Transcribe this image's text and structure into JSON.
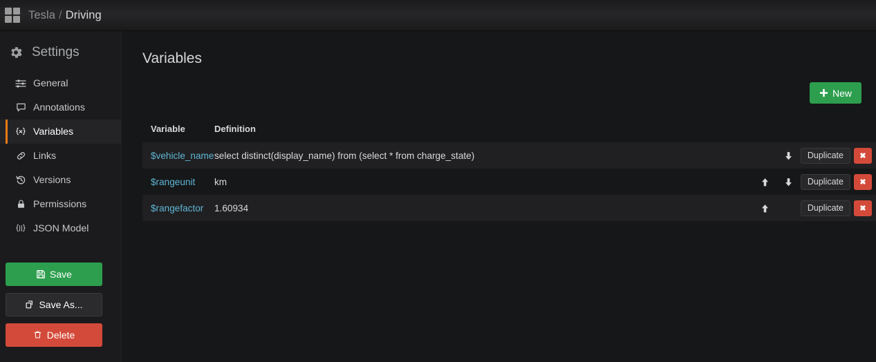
{
  "topnav": {
    "logo_icon": "grid-icon",
    "breadcrumb_parent": "Tesla",
    "breadcrumb_separator": "/",
    "breadcrumb_current": "Driving"
  },
  "sidebar": {
    "heading": "Settings",
    "heading_icon": "gear-icon",
    "items": [
      {
        "label": "General",
        "icon": "sliders-icon",
        "active": false
      },
      {
        "label": "Annotations",
        "icon": "comment-icon",
        "active": false
      },
      {
        "label": "Variables",
        "icon": "braces-x-icon",
        "active": true
      },
      {
        "label": "Links",
        "icon": "link-icon",
        "active": false
      },
      {
        "label": "Versions",
        "icon": "history-icon",
        "active": false
      },
      {
        "label": "Permissions",
        "icon": "lock-icon",
        "active": false
      },
      {
        "label": "JSON Model",
        "icon": "json-icon",
        "active": false
      }
    ],
    "actions": [
      {
        "label": "Save",
        "icon": "save-icon",
        "color": "#2d9e4e"
      },
      {
        "label": "Save As...",
        "icon": "copy-icon",
        "color": "#2b2b2e"
      },
      {
        "label": "Delete",
        "icon": "trash-icon",
        "color": "#d44a3a"
      }
    ]
  },
  "main": {
    "title": "Variables",
    "new_button": {
      "label": "New",
      "icon": "plus-icon"
    },
    "table": {
      "columns": [
        "Variable",
        "Definition"
      ],
      "duplicate_label": "Duplicate",
      "delete_label": "✖",
      "rows": [
        {
          "variable": "$vehicle_name",
          "definition": "select distinct(display_name) from (select * from charge_state)",
          "can_move_up": false,
          "can_move_down": true
        },
        {
          "variable": "$rangeunit",
          "definition": "km",
          "can_move_up": true,
          "can_move_down": true
        },
        {
          "variable": "$rangefactor",
          "definition": "1.60934",
          "can_move_up": true,
          "can_move_down": false
        }
      ]
    }
  },
  "colors": {
    "accent_orange": "#eb7b18",
    "link_blue": "#5fb6d4",
    "success_green": "#2d9e4e",
    "danger_red": "#d44a3a",
    "page_bg": "#161719",
    "sidebar_bg": "#1b1b1d"
  }
}
